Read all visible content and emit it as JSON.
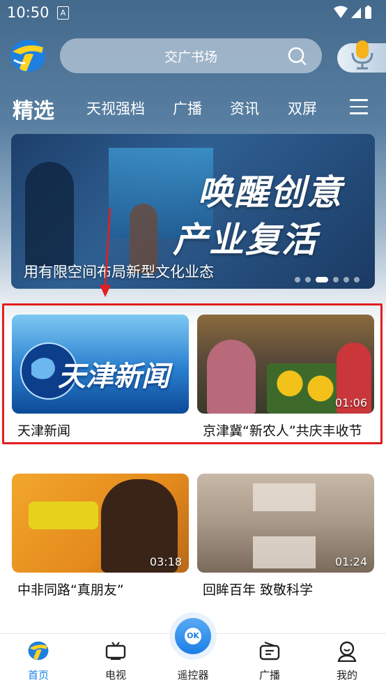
{
  "status": {
    "time": "10:50",
    "notification_glyph": "A"
  },
  "header": {
    "search_placeholder": "交广书场"
  },
  "nav": {
    "active": "精选",
    "items": [
      "天视强档",
      "广播",
      "资讯",
      "双屏"
    ]
  },
  "banner": {
    "headline_line1": "唤醒创意",
    "headline_line2": "产业复活",
    "caption": "用有限空间布局新型文化业态",
    "page_count": 6,
    "active_page": 3
  },
  "cards": [
    {
      "title": "天津新闻",
      "thumb_text": "天津新闻",
      "duration": ""
    },
    {
      "title": "京津冀“新农人”共庆丰收节",
      "duration": "01:06"
    },
    {
      "title": "中非同路“真朋友”",
      "duration": "03:18"
    },
    {
      "title": "回眸百年 致敬科学",
      "duration": "01:24"
    }
  ],
  "tabbar": {
    "home": "首页",
    "tv": "电视",
    "remote": "遥控器",
    "remote_ok": "OK",
    "radio": "广播",
    "mine": "我的"
  },
  "colors": {
    "accent": "#1b84e8",
    "highlight": "#e41e1e",
    "header_bg": "#43698c"
  }
}
